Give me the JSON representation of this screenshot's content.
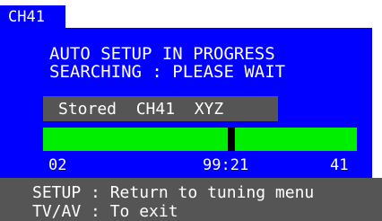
{
  "channel_tab": "CH41",
  "status": {
    "line1": "AUTO SETUP IN PROGRESS",
    "line2": "SEARCHING : PLEASE WAIT"
  },
  "stored": {
    "text": "Stored  CH41  XYZ"
  },
  "progress": {
    "start": "02",
    "current": "99:21",
    "end": "41",
    "marker_fraction": 0.601,
    "bar_color": "#00ee00",
    "marker_color": "#000000"
  },
  "footer": {
    "line1": "SETUP : Return to tuning menu",
    "line2": "TV/AV : To exit"
  },
  "colors": {
    "panel": "#0000ff",
    "grey": "#555555",
    "text": "#ffffff"
  }
}
